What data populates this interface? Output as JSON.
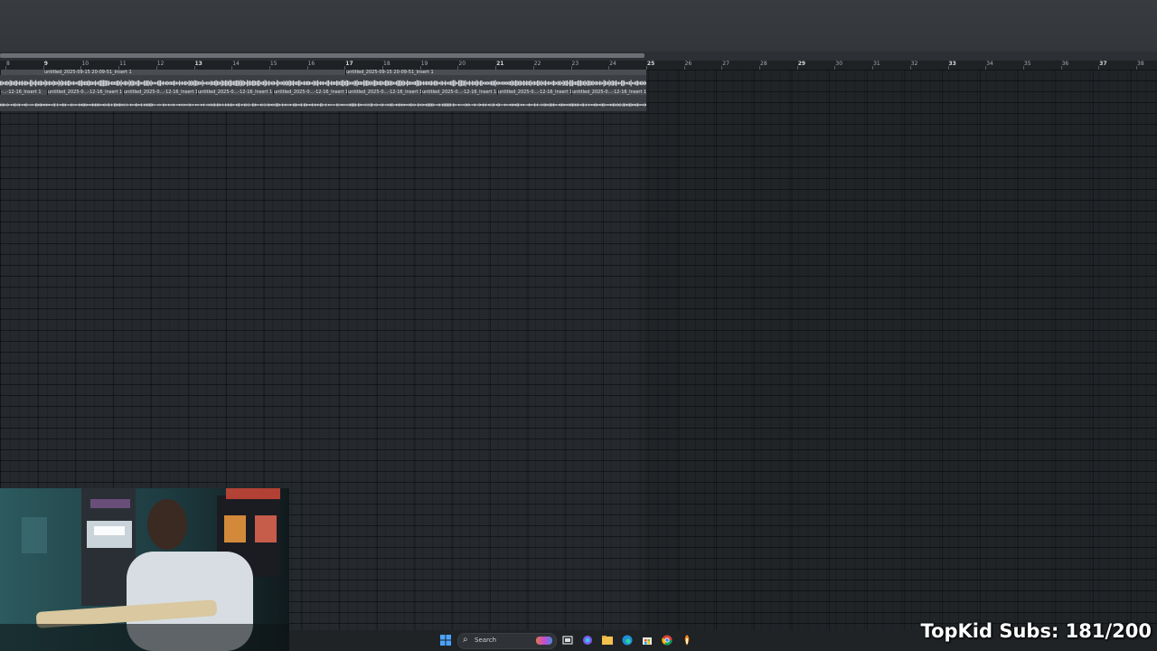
{
  "ruler": {
    "bars": [
      "8",
      "9",
      "10",
      "11",
      "12",
      "13",
      "14",
      "15",
      "16",
      "17",
      "18",
      "19",
      "20",
      "21",
      "22",
      "23",
      "24",
      "25",
      "26",
      "27",
      "28",
      "29",
      "30",
      "31",
      "32",
      "33",
      "34",
      "35",
      "36",
      "37",
      "38"
    ],
    "major": [
      "9",
      "13",
      "17",
      "21",
      "25",
      "29",
      "33",
      "37"
    ]
  },
  "tracks": [
    {
      "clips": [
        {
          "label": "untitled_2025-09-15 20-09-51_Insert 1"
        },
        {
          "label": "untitled_2025-09-15 20-09-51_Insert 1"
        }
      ]
    },
    {
      "clips": [
        {
          "label": "-...-12-16_Insert 1"
        },
        {
          "label": "untitled_2025-0...-12-16_Insert 1"
        },
        {
          "label": "untitled_2025-0...-12-16_Insert 1"
        },
        {
          "label": "untitled_2025-0...-12-16_Insert 1"
        },
        {
          "label": "untitled_2025-0...-12-16_Insert 1"
        },
        {
          "label": "untitled_2025-0...-12-16_Insert 1"
        },
        {
          "label": "untitled_2025-0...-12-16_Insert 1"
        },
        {
          "label": "untitled_2025-0...-12-16_Insert 1"
        },
        {
          "label": "untitled_2025-0...-12-16_Insert 1"
        }
      ]
    }
  ],
  "taskbar": {
    "search_label": "Search",
    "icons": [
      "windows-start-icon",
      "search-icon",
      "widgets-icon",
      "task-view-icon",
      "copilot-icon",
      "file-explorer-icon",
      "edge-icon",
      "microsoft-store-icon",
      "chrome-icon",
      "fl-studio-icon"
    ]
  },
  "overlay": {
    "subs_text": "TopKid Subs: 181/200"
  }
}
